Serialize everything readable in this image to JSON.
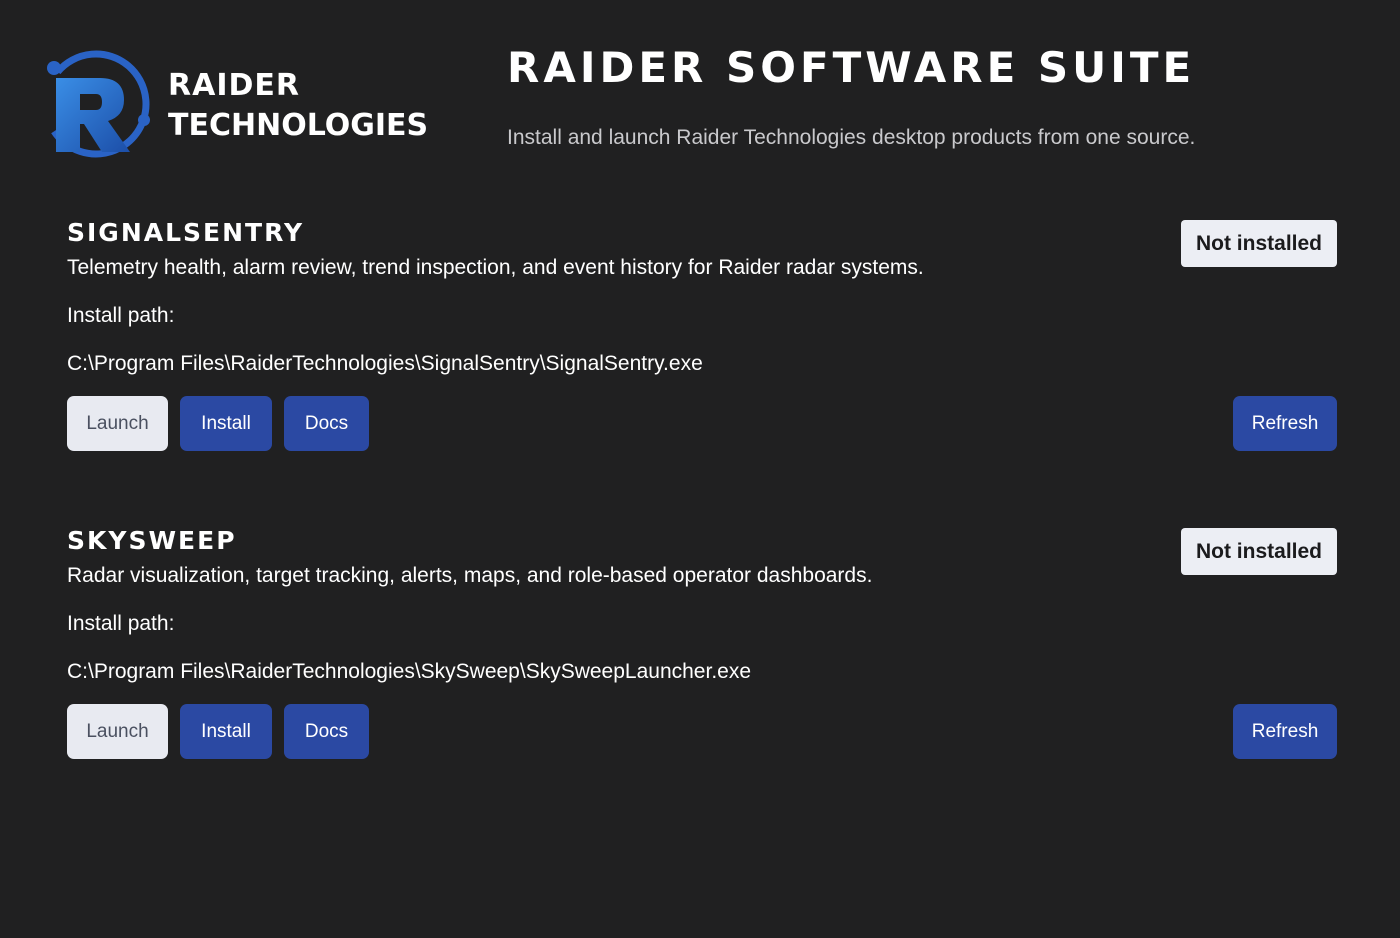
{
  "header": {
    "logo_line1": "RAIDER",
    "logo_line2": "TECHNOLOGIES",
    "title": "RAIDER SOFTWARE SUITE",
    "subtitle": "Install and launch Raider Technologies desktop products from one source."
  },
  "colors": {
    "background": "#202021",
    "accent_button": "#2b49a3",
    "light_button": "#e8eaf1",
    "badge": "#eceef4",
    "logo_blue": "#2e7fd6"
  },
  "products": [
    {
      "name": "SIGNALSENTRY",
      "description": "Telemetry health, alarm review, trend inspection, and event history for Raider radar systems.",
      "path_label": "Install path:",
      "path": "C:\\Program Files\\RaiderTechnologies\\SignalSentry\\SignalSentry.exe",
      "status": "Not installed",
      "buttons": {
        "launch": "Launch",
        "install": "Install",
        "docs": "Docs",
        "refresh": "Refresh"
      }
    },
    {
      "name": "SKYSWEEP",
      "description": "Radar visualization, target tracking, alerts, maps, and role-based operator dashboards.",
      "path_label": "Install path:",
      "path": "C:\\Program Files\\RaiderTechnologies\\SkySweep\\SkySweepLauncher.exe",
      "status": "Not installed",
      "buttons": {
        "launch": "Launch",
        "install": "Install",
        "docs": "Docs",
        "refresh": "Refresh"
      }
    }
  ]
}
